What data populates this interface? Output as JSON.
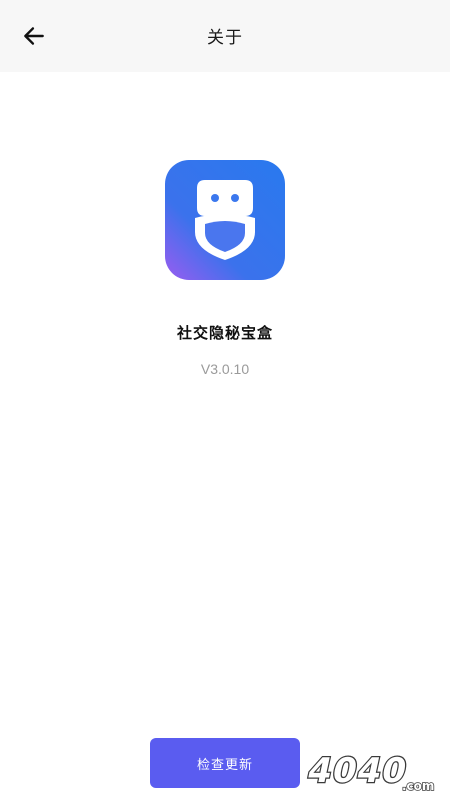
{
  "header": {
    "title": "关于"
  },
  "app": {
    "name": "社交隐秘宝盒",
    "version": "V3.0.10"
  },
  "footer": {
    "check_update_label": "检查更新"
  },
  "watermark": {
    "text": "4040",
    "suffix": ".com"
  },
  "colors": {
    "header_bg": "#f7f7f7",
    "accent": "#5a5cf0",
    "icon_gradient_start": "#2f7bf0",
    "icon_gradient_end": "#8a5cf0",
    "version_text": "#9a9a9a"
  },
  "icons": {
    "back": "arrow-left-icon",
    "app": "shield-chat-icon"
  }
}
